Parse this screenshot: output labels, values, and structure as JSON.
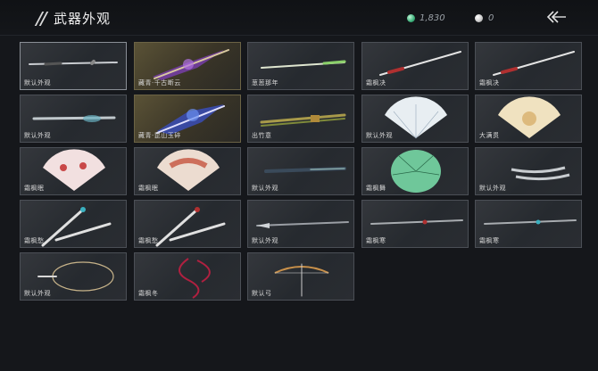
{
  "header": {
    "title": "武器外观",
    "jade_amount": "1,830",
    "pearl_amount": "0"
  },
  "items": [
    {
      "label": "默认外观",
      "kind": "sword"
    },
    {
      "label": "藏青·千古断云",
      "kind": "fancy-sword"
    },
    {
      "label": "葱葱那年",
      "kind": "green-sword"
    },
    {
      "label": "霜枫决",
      "kind": "sword-red"
    },
    {
      "label": "霜枫决",
      "kind": "sword-red"
    },
    {
      "label": "默认外观",
      "kind": "ornate-blade"
    },
    {
      "label": "藏青·昆山玉碎",
      "kind": "fancy-blue"
    },
    {
      "label": "出竹意",
      "kind": "bamboo"
    },
    {
      "label": "默认外观",
      "kind": "fan-white"
    },
    {
      "label": "大满贯",
      "kind": "fan-gold"
    },
    {
      "label": "霜枫眠",
      "kind": "fan-pink"
    },
    {
      "label": "霜枫眠",
      "kind": "fan-red"
    },
    {
      "label": "默认外观",
      "kind": "umbrella-closed"
    },
    {
      "label": "霜枫舞",
      "kind": "umbrella-open"
    },
    {
      "label": "默认外观",
      "kind": "dual-blades"
    },
    {
      "label": "霜枫愁",
      "kind": "cross-swords"
    },
    {
      "label": "霜枫愁",
      "kind": "cross-swords-red"
    },
    {
      "label": "默认外观",
      "kind": "spear"
    },
    {
      "label": "霜枫寒",
      "kind": "spear-red"
    },
    {
      "label": "霜枫寒",
      "kind": "spear-blue"
    },
    {
      "label": "默认外观",
      "kind": "rope-dart"
    },
    {
      "label": "霜枫冬",
      "kind": "rope-dart-red"
    },
    {
      "label": "默认弓",
      "kind": "bow"
    }
  ]
}
